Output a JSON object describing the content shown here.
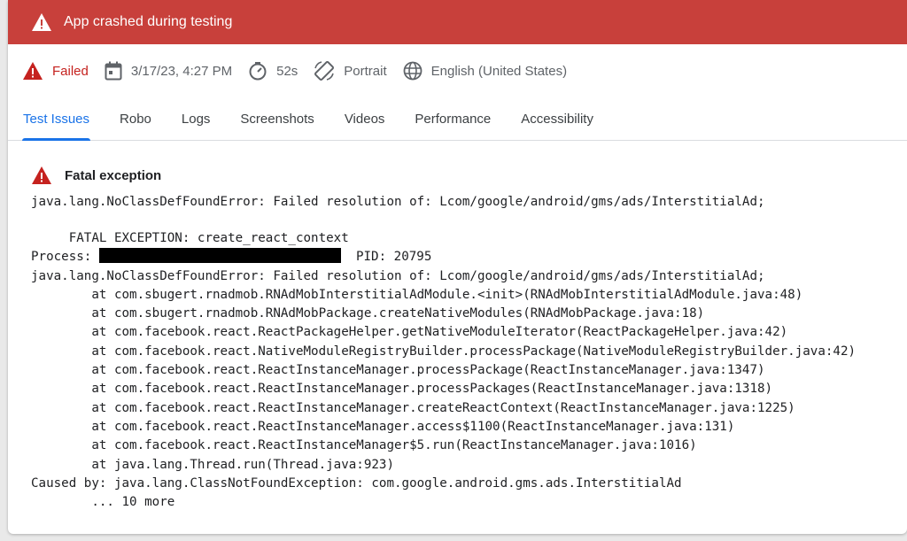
{
  "banner": {
    "title": "App crashed during testing",
    "icon": "warning-icon"
  },
  "meta": {
    "status": "Failed",
    "datetime": "3/17/23, 4:27 PM",
    "duration": "52s",
    "orientation": "Portrait",
    "locale": "English (United States)"
  },
  "tabs": [
    {
      "label": "Test Issues",
      "active": true
    },
    {
      "label": "Robo"
    },
    {
      "label": "Logs"
    },
    {
      "label": "Screenshots"
    },
    {
      "label": "Videos"
    },
    {
      "label": "Performance"
    },
    {
      "label": "Accessibility"
    }
  ],
  "issue": {
    "title": "Fatal exception",
    "summary": "java.lang.NoClassDefFoundError: Failed resolution of: Lcom/google/android/gms/ads/InterstitialAd;",
    "trace_line1": "     FATAL EXCEPTION: create_react_context",
    "process_label": "Process: ",
    "pid_text": "  PID: 20795",
    "trace_rest": "java.lang.NoClassDefFoundError: Failed resolution of: Lcom/google/android/gms/ads/InterstitialAd;\n        at com.sbugert.rnadmob.RNAdMobInterstitialAdModule.<init>(RNAdMobInterstitialAdModule.java:48)\n        at com.sbugert.rnadmob.RNAdMobPackage.createNativeModules(RNAdMobPackage.java:18)\n        at com.facebook.react.ReactPackageHelper.getNativeModuleIterator(ReactPackageHelper.java:42)\n        at com.facebook.react.NativeModuleRegistryBuilder.processPackage(NativeModuleRegistryBuilder.java:42)\n        at com.facebook.react.ReactInstanceManager.processPackage(ReactInstanceManager.java:1347)\n        at com.facebook.react.ReactInstanceManager.processPackages(ReactInstanceManager.java:1318)\n        at com.facebook.react.ReactInstanceManager.createReactContext(ReactInstanceManager.java:1225)\n        at com.facebook.react.ReactInstanceManager.access$1100(ReactInstanceManager.java:131)\n        at com.facebook.react.ReactInstanceManager$5.run(ReactInstanceManager.java:1016)\n        at java.lang.Thread.run(Thread.java:923)\nCaused by: java.lang.ClassNotFoundException: com.google.android.gms.ads.InterstitialAd\n        ... 10 more"
  },
  "colors": {
    "banner": "#c8403b",
    "failed": "#c5221f",
    "accent": "#1a73e8"
  }
}
